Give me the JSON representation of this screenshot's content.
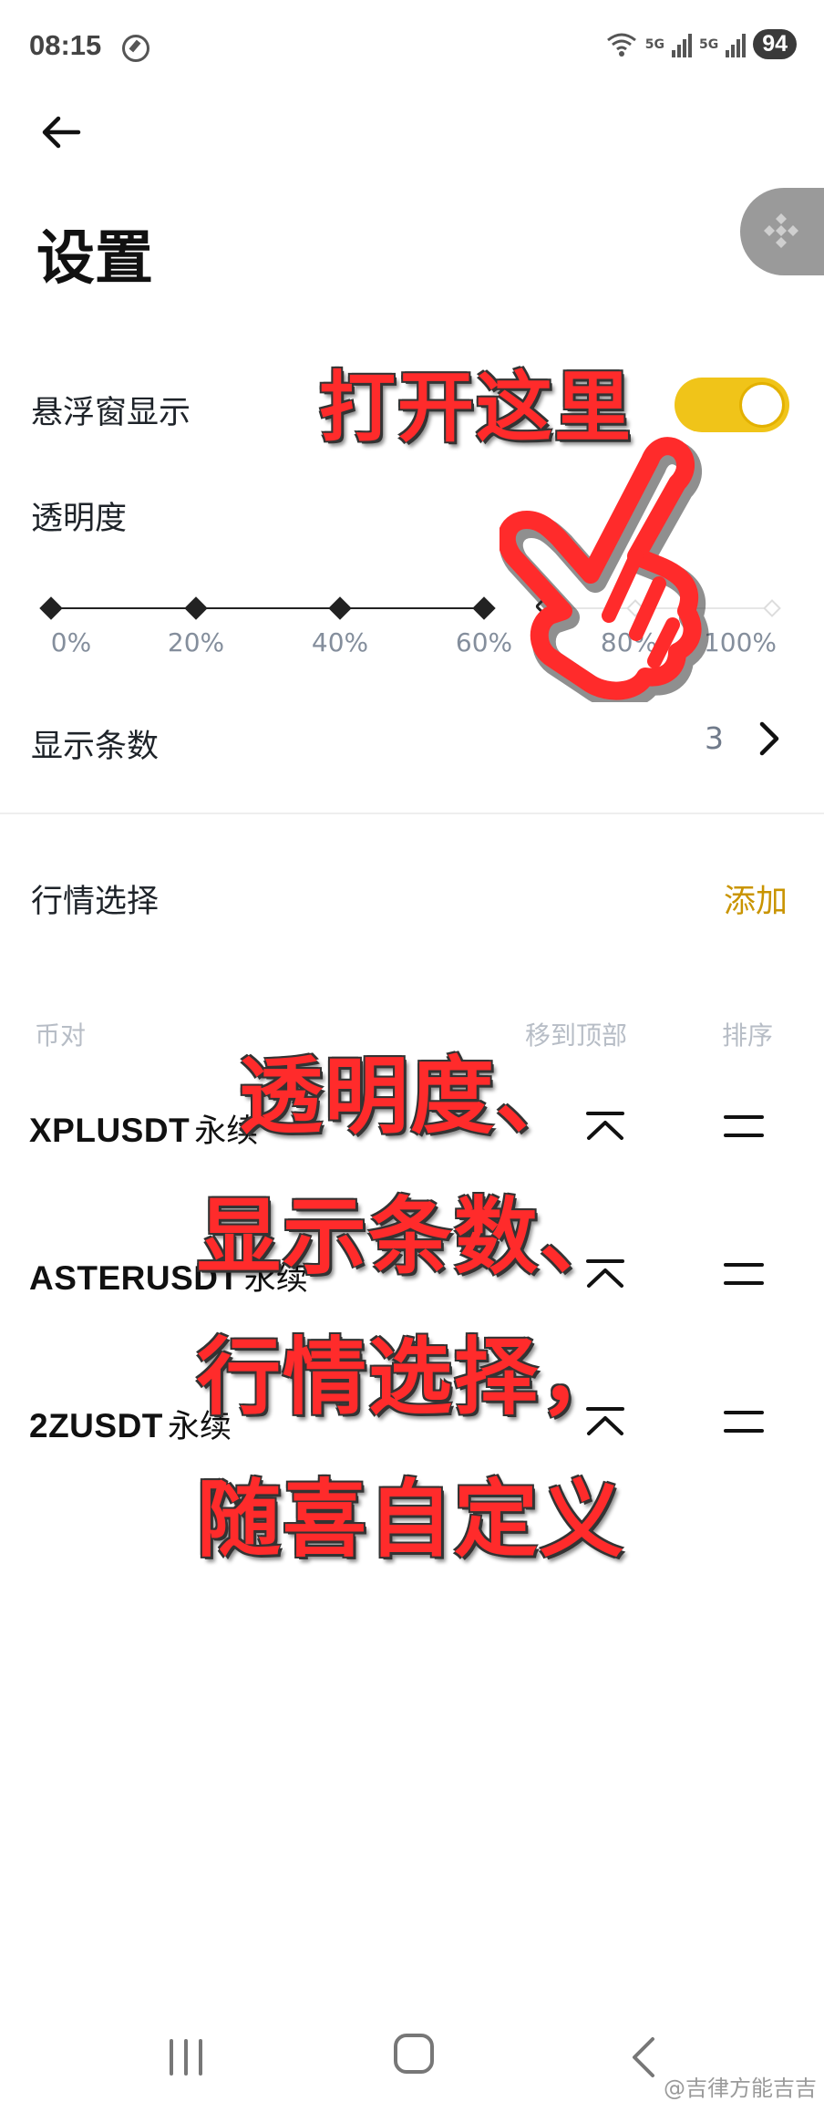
{
  "status": {
    "time": "08:15",
    "sig1": "5G",
    "sig2": "5G",
    "battery": "94"
  },
  "header": {
    "title": "设置"
  },
  "floating_window": {
    "label": "悬浮窗显示",
    "enabled": true
  },
  "opacity": {
    "label": "透明度",
    "ticks": [
      "0%",
      "20%",
      "40%",
      "60%",
      "80%",
      "100%"
    ],
    "value_percent": 70
  },
  "display_count": {
    "label": "显示条数",
    "value": "3"
  },
  "market": {
    "label": "行情选择",
    "add_label": "添加",
    "col_pair": "币对",
    "col_to_top": "移到顶部",
    "col_sort": "排序",
    "rows": [
      {
        "name": "XPLUSDT",
        "type": "永续"
      },
      {
        "name": "ASTERUSDT",
        "type": "永续"
      },
      {
        "name": "2ZUSDT",
        "type": "永续"
      }
    ]
  },
  "annotations": {
    "open_here": "打开这里",
    "line1": "透明度、",
    "line2": "显示条数、",
    "line3": "行情选择，",
    "line4": "随喜自定义"
  },
  "watermark": "@吉律方能吉吉",
  "colors": {
    "accent": "#F0C419",
    "link": "#C99400",
    "annotation": "#FF2B2B"
  }
}
